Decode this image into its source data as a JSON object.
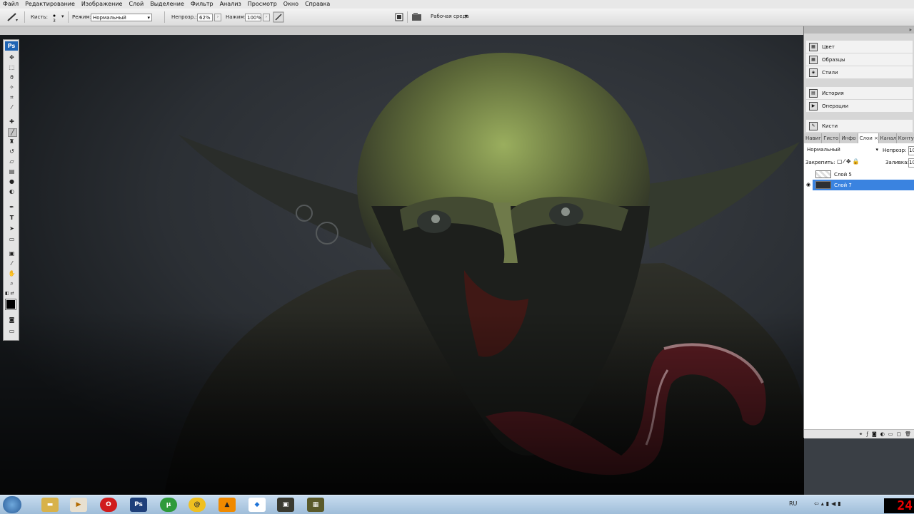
{
  "menu": [
    "Файл",
    "Редактирование",
    "Изображение",
    "Слой",
    "Выделение",
    "Фильтр",
    "Анализ",
    "Просмотр",
    "Окно",
    "Справка"
  ],
  "options": {
    "brush_label": "Кисть:",
    "brush_size": "3",
    "mode_label": "Режим:",
    "mode_value": "Нормальный",
    "opacity_label": "Непрозр.:",
    "opacity_value": "62%",
    "pressure_label": "Нажим:",
    "pressure_value": "100%",
    "workspace_label": "Рабочая среда"
  },
  "toolbox": {
    "logo": "Ps",
    "tools": [
      "move-tool",
      "marquee-tool",
      "lasso-tool",
      "magic-wand-tool",
      "crop-tool",
      "eyedropper-tool",
      "healing-tool",
      "brush-tool",
      "clone-stamp-tool",
      "history-brush-tool",
      "eraser-tool",
      "gradient-tool",
      "blur-tool",
      "dodge-tool",
      "pen-tool",
      "type-tool",
      "path-select-tool",
      "shape-tool",
      "notes-tool",
      "eyedropper2-tool",
      "hand-tool",
      "zoom-tool"
    ],
    "colors": {
      "foreground": "#000000",
      "background": "#ffffff"
    }
  },
  "dock": {
    "items": [
      {
        "label": "Цвет",
        "icon": "color-panel-icon"
      },
      {
        "label": "Образцы",
        "icon": "swatches-panel-icon"
      },
      {
        "label": "Стили",
        "icon": "styles-panel-icon"
      },
      {
        "label": "История",
        "icon": "history-panel-icon"
      },
      {
        "label": "Операции",
        "icon": "actions-panel-icon"
      },
      {
        "label": "Кисти",
        "icon": "brushes-panel-icon"
      }
    ]
  },
  "layers_panel": {
    "tabs": [
      "Навиг",
      "Гисто",
      "Инфо",
      "Слои ×",
      "Каналы",
      "Контуры"
    ],
    "blend_mode": "Нормальный",
    "opacity_label": "Непрозр:",
    "opacity_value": "10",
    "lock_label": "Закрепить:",
    "fill_label": "Заливка:",
    "fill_value": "10",
    "layers": [
      {
        "name": "Слой 5",
        "visible": false,
        "selected": false
      },
      {
        "name": "Слой 7",
        "visible": true,
        "selected": true
      }
    ]
  },
  "taskbar": {
    "start_icon": "windows-start-icon",
    "apps": [
      "explorer-icon",
      "media-player-icon",
      "opera-icon",
      "photoshop-icon",
      "utorrent-icon",
      "mail-agent-icon",
      "avast-icon",
      "dropbox-icon",
      "app-icon-1",
      "app-icon-2"
    ],
    "ps_label": "Ps",
    "lang": "RU",
    "clock": "24"
  }
}
